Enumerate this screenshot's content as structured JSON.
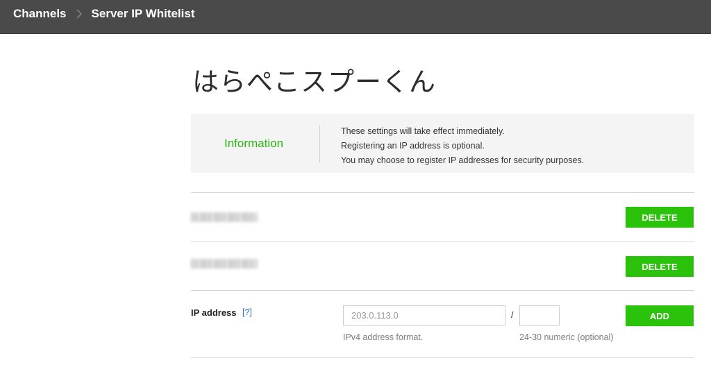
{
  "breadcrumb": {
    "items": [
      {
        "label": "Channels"
      },
      {
        "label": "Server IP Whitelist"
      }
    ]
  },
  "channel": {
    "title": "はらぺこスプーくん"
  },
  "information": {
    "label": "Information",
    "lines": [
      "These settings will take effect immediately.",
      "Registering an IP address is optional.",
      "You may choose to register IP addresses for security purposes."
    ]
  },
  "whitelist": {
    "rows": [
      {
        "ip_redacted": true,
        "delete_label": "DELETE"
      },
      {
        "ip_redacted": true,
        "delete_label": "DELETE"
      }
    ]
  },
  "add_form": {
    "label": "IP address",
    "help_link": "[?]",
    "ip_placeholder": "203.0.113.0",
    "separator": "/",
    "cidr_value": "",
    "ip_hint": "IPv4 address format.",
    "cidr_hint": "24-30 numeric (optional)",
    "add_label": "ADD"
  },
  "colors": {
    "accent_green": "#2bc20b",
    "info_label_green": "#2ab514",
    "topbar_bg": "#4a4a4a",
    "link_blue": "#2770c2"
  },
  "icons": {
    "breadcrumb_separator": "chevron-right-icon"
  }
}
